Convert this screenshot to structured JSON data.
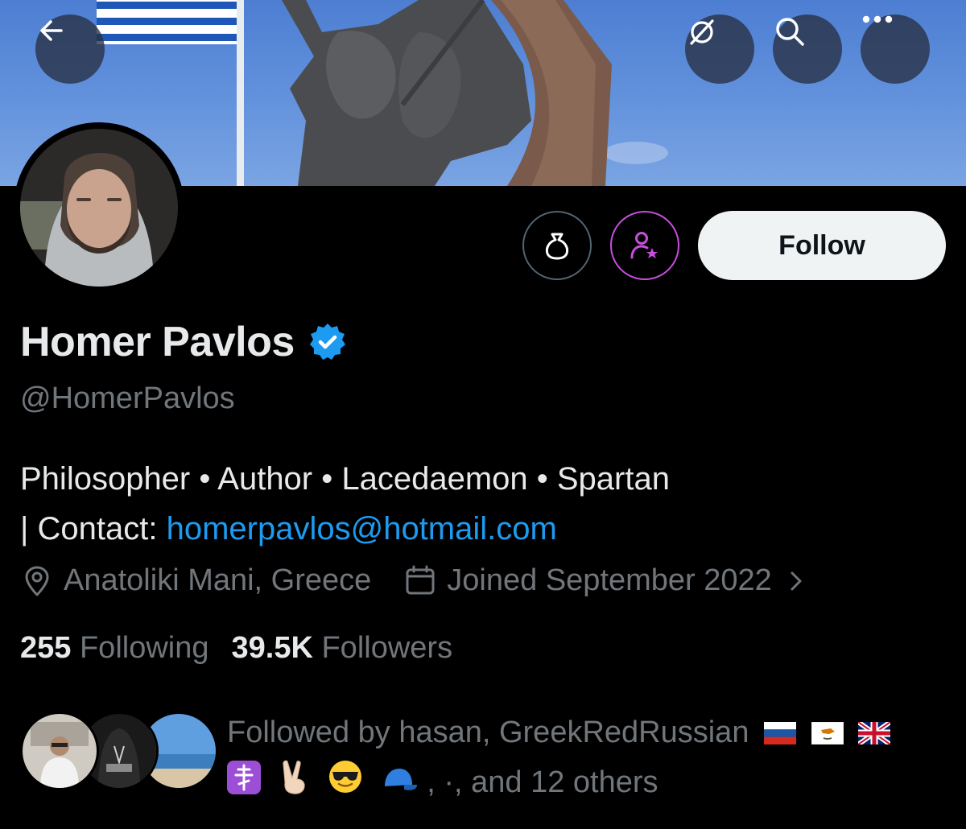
{
  "header": {
    "back_icon": "arrow-left-icon",
    "grok_icon": "slashed-circle-icon",
    "search_icon": "search-icon",
    "more_icon": "more-icon"
  },
  "actions": {
    "tip_icon": "money-bag-icon",
    "subscribe_icon": "person-star-icon",
    "follow_label": "Follow"
  },
  "profile": {
    "name": "Homer Pavlos",
    "handle": "@HomerPavlos",
    "bio_line1": "Philosopher • Author • Lacedaemon • Spartan",
    "bio_line2_prefix": "| Contact: ",
    "bio_email": "homerpavlos@hotmail.com",
    "location": "Anatoliki Mani, Greece",
    "joined": "Joined September 2022",
    "following_count": "255",
    "following_label": "Following",
    "followers_count": "39.5K",
    "followers_label": "Followers"
  },
  "followed_by": {
    "line1": "Followed by hasan, GreekRedRussian",
    "line2_suffix": ", ·, and 12 others",
    "emojis_line1": [
      "🇷🇺",
      "🇨🇾",
      "🇬🇧"
    ],
    "emojis_line2": [
      "☦️",
      "✌️",
      "😎",
      "🧢"
    ]
  },
  "colors": {
    "accent": "#1d9bf0",
    "verified": "#1d9bf0",
    "subscribe_ring": "#c94ee0",
    "muted": "#71767b",
    "background": "#000000"
  }
}
